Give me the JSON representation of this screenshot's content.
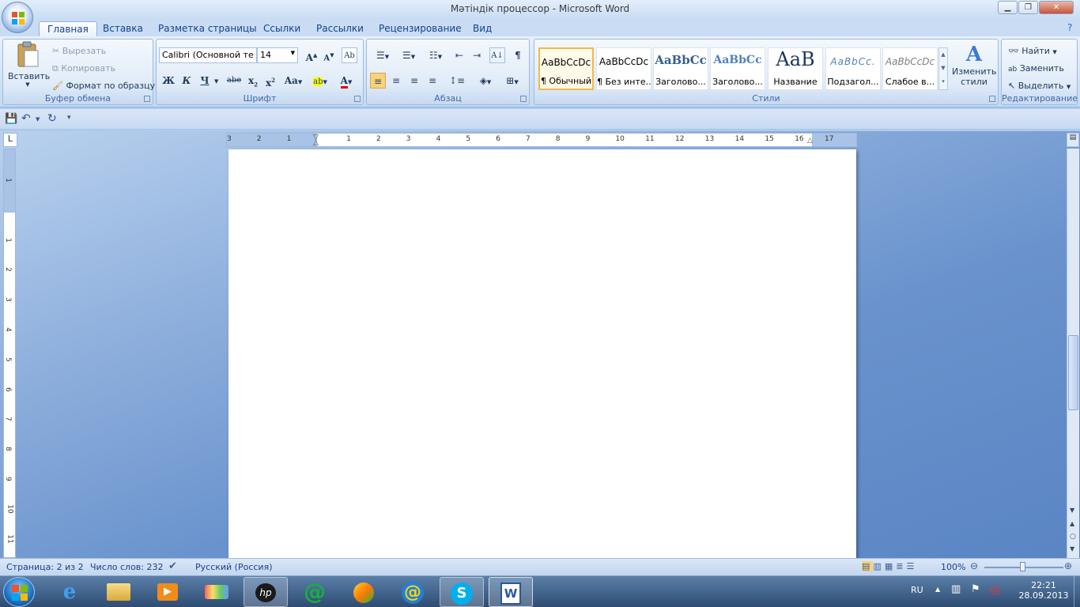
{
  "window": {
    "title": "Мәтіндік процессор - Microsoft Word"
  },
  "tabs": [
    "Главная",
    "Вставка",
    "Разметка страницы",
    "Ссылки",
    "Рассылки",
    "Рецензирование",
    "Вид"
  ],
  "clipboard": {
    "paste_label": "Вставить",
    "cut_label": "Вырезать",
    "copy_label": "Копировать",
    "format_painter_label": "Формат по образцу",
    "group_label": "Буфер обмена"
  },
  "font": {
    "font_name": "Calibri (Основной те",
    "font_size": "14",
    "bold_label": "Ж",
    "italic_label": "К",
    "underline_label": "Ч",
    "strike_label": "abe",
    "group_label": "Шрифт"
  },
  "paragraph": {
    "group_label": "Абзац"
  },
  "styles": {
    "items": [
      {
        "preview": "AaBbCcDc",
        "name": "¶ Обычный"
      },
      {
        "preview": "AaBbCcDc",
        "name": "¶ Без инте..."
      },
      {
        "preview": "AaBbCc",
        "name": "Заголово..."
      },
      {
        "preview": "AaBbCc",
        "name": "Заголово..."
      },
      {
        "preview": "AaB",
        "name": "Название"
      },
      {
        "preview": "AaBbCc.",
        "name": "Подзагол..."
      },
      {
        "preview": "AaBbCcDc",
        "name": "Слабое в..."
      }
    ],
    "change_styles_label_1": "Изменить",
    "change_styles_label_2": "стили",
    "group_label": "Стили"
  },
  "editing": {
    "find_label": "Найти",
    "replace_label": "Заменить",
    "select_label": "Выделить",
    "group_label": "Редактирование"
  },
  "ruler": {
    "h_labels": [
      "3",
      "2",
      "1",
      "1",
      "2",
      "3",
      "4",
      "5",
      "6",
      "7",
      "8",
      "9",
      "10",
      "11",
      "12",
      "13",
      "14",
      "15",
      "16",
      "17"
    ],
    "v_labels": [
      "1",
      "1",
      "2",
      "3",
      "4",
      "5",
      "6",
      "7",
      "8",
      "9",
      "10",
      "11"
    ]
  },
  "status": {
    "page": "Страница: 2 из 2",
    "words": "Число слов: 232",
    "language": "Русский (Россия)",
    "zoom": "100%"
  },
  "taskbar": {
    "lang": "RU",
    "time": "22:21",
    "date": "28.09.2013"
  },
  "colors": {
    "accent": "#15428b",
    "highlight": "#f2b94c"
  }
}
